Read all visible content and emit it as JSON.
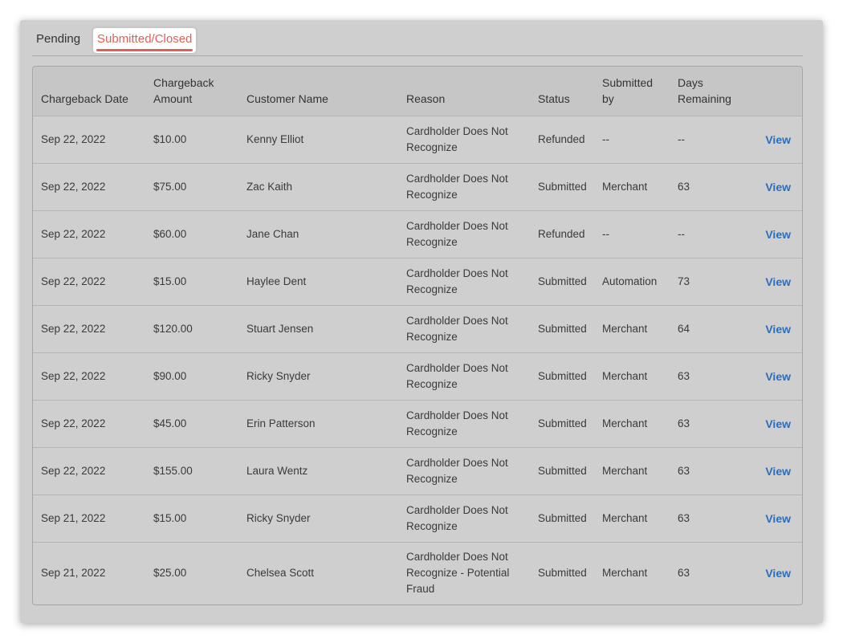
{
  "tabs": [
    {
      "label": "Pending"
    },
    {
      "label": "Submitted/Closed"
    }
  ],
  "table": {
    "headers": {
      "date": "Chargeback Date",
      "amount": "Chargeback Amount",
      "customer": "Customer Name",
      "reason": "Reason",
      "status": "Status",
      "submitted_by": "Submitted by",
      "days": "Days Remaining"
    },
    "rows": [
      {
        "date": "Sep 22, 2022",
        "amount": "$10.00",
        "customer": "Kenny Elliot",
        "reason": "Cardholder Does Not Recognize",
        "status": "Refunded",
        "submitted_by": "--",
        "days": "--",
        "action": "View"
      },
      {
        "date": "Sep 22, 2022",
        "amount": "$75.00",
        "customer": "Zac Kaith",
        "reason": "Cardholder Does Not Recognize",
        "status": "Submitted",
        "submitted_by": "Merchant",
        "days": "63",
        "action": "View"
      },
      {
        "date": "Sep 22, 2022",
        "amount": "$60.00",
        "customer": "Jane Chan",
        "reason": "Cardholder Does Not Recognize",
        "status": "Refunded",
        "submitted_by": "--",
        "days": "--",
        "action": "View"
      },
      {
        "date": "Sep 22, 2022",
        "amount": "$15.00",
        "customer": "Haylee Dent",
        "reason": "Cardholder Does Not Recognize",
        "status": "Submitted",
        "submitted_by": "Automation",
        "days": "73",
        "action": "View"
      },
      {
        "date": "Sep 22, 2022",
        "amount": "$120.00",
        "customer": "Stuart Jensen",
        "reason": "Cardholder Does Not Recognize",
        "status": "Submitted",
        "submitted_by": "Merchant",
        "days": "64",
        "action": "View"
      },
      {
        "date": "Sep 22, 2022",
        "amount": "$90.00",
        "customer": "Ricky Snyder",
        "reason": "Cardholder Does Not Recognize",
        "status": "Submitted",
        "submitted_by": "Merchant",
        "days": "63",
        "action": "View"
      },
      {
        "date": "Sep 22, 2022",
        "amount": "$45.00",
        "customer": "Erin Patterson",
        "reason": "Cardholder Does Not Recognize",
        "status": "Submitted",
        "submitted_by": "Merchant",
        "days": "63",
        "action": "View"
      },
      {
        "date": "Sep 22, 2022",
        "amount": "$155.00",
        "customer": "Laura Wentz",
        "reason": "Cardholder Does Not Recognize",
        "status": "Submitted",
        "submitted_by": "Merchant",
        "days": "63",
        "action": "View"
      },
      {
        "date": "Sep 21, 2022",
        "amount": "$15.00",
        "customer": "Ricky Snyder",
        "reason": "Cardholder Does Not Recognize",
        "status": "Submitted",
        "submitted_by": "Merchant",
        "days": "63",
        "action": "View"
      },
      {
        "date": "Sep 21, 2022",
        "amount": "$25.00",
        "customer": "Chelsea Scott",
        "reason": "Cardholder Does Not Recognize - Potential Fraud",
        "status": "Submitted",
        "submitted_by": "Merchant",
        "days": "63",
        "action": "View"
      }
    ]
  },
  "colors": {
    "active_tab": "#e25f57",
    "link": "#2a6ebd",
    "panel_bg": "#cfcfcf"
  }
}
